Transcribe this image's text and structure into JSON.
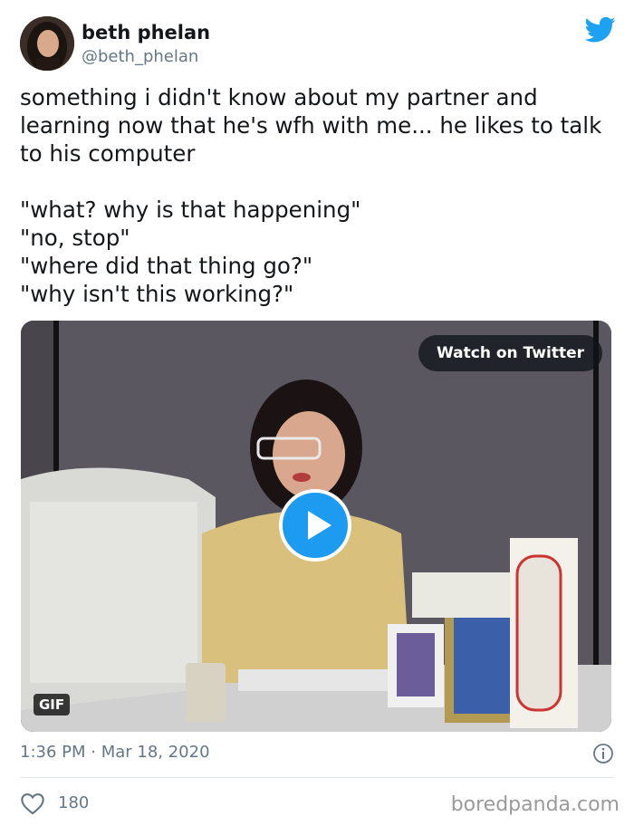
{
  "tweet": {
    "author_name": "beth phelan",
    "author_handle": "@beth_phelan",
    "text": "something i didn't know about my partner and learning now that he's wfh with me... he likes to talk to his computer\n\n\"what? why is that happening\"\n\"no, stop\"\n\"where did that thing go?\"\n\"why isn't this working?\"",
    "timestamp": "1:36 PM · Mar 18, 2020",
    "like_count": "180"
  },
  "media": {
    "watch_label": "Watch on Twitter",
    "gif_label": "GIF"
  },
  "watermark": "boredpanda.com",
  "colors": {
    "twitter_blue": "#1da1f2",
    "play_blue": "#1d9bf0",
    "secondary_text": "#657786"
  },
  "icons": [
    "twitter-bird-icon",
    "play-icon",
    "info-icon",
    "heart-icon"
  ]
}
